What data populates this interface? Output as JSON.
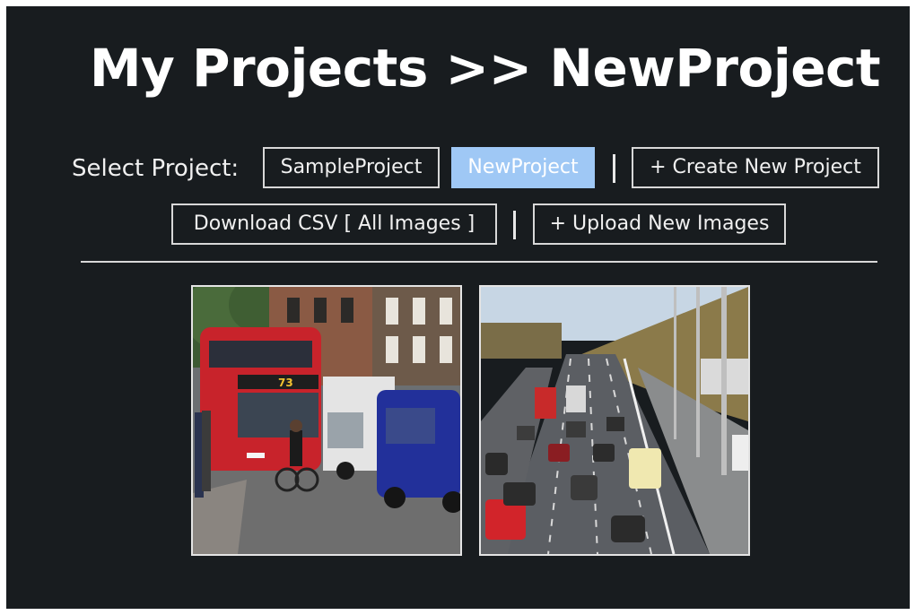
{
  "header": {
    "title": "My Projects >> NewProject"
  },
  "project_bar": {
    "label": "Select Project:",
    "projects": [
      "SampleProject",
      "NewProject"
    ],
    "active_project": "NewProject",
    "separator": "|",
    "create_label": "+ Create New Project"
  },
  "actions": {
    "download_label": "Download CSV [ All Images ]",
    "separator": "|",
    "upload_label": "+ Upload New Images"
  },
  "gallery": {
    "images": [
      {
        "name": "street-bus-photo"
      },
      {
        "name": "highway-traffic-photo"
      }
    ]
  },
  "colors": {
    "background": "#181c1f",
    "active_button": "#9fc8f5",
    "border": "#d8d8d8",
    "text": "#ffffff"
  }
}
